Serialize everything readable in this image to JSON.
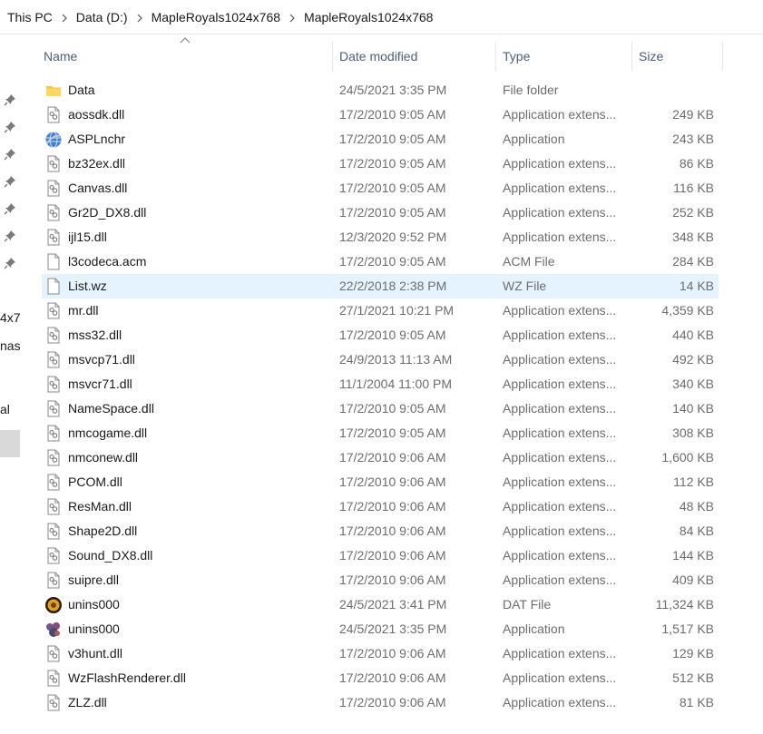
{
  "breadcrumb": [
    "This PC",
    "Data (D:)",
    "MapleRoyals1024x768",
    "MapleRoyals1024x768"
  ],
  "nav_fragments": [
    "4x7",
    "nas",
    "al"
  ],
  "columns": {
    "name": "Name",
    "date": "Date modified",
    "type": "Type",
    "size": "Size"
  },
  "colors": {
    "header_text": "#4c607a",
    "selected_row": "#e5f3ff",
    "folder": "#f6c445"
  },
  "files": [
    {
      "name": "Data",
      "date": "24/5/2021 3:35 PM",
      "type": "File folder",
      "size": "",
      "icon": "folder-icon"
    },
    {
      "name": "aossdk.dll",
      "date": "17/2/2010 9:05 AM",
      "type": "Application extens...",
      "size": "249 KB",
      "icon": "dll-file-icon"
    },
    {
      "name": "ASPLnchr",
      "date": "17/2/2010 9:05 AM",
      "type": "Application",
      "size": "243 KB",
      "icon": "globe-app-icon"
    },
    {
      "name": "bz32ex.dll",
      "date": "17/2/2010 9:05 AM",
      "type": "Application extens...",
      "size": "86 KB",
      "icon": "dll-file-icon"
    },
    {
      "name": "Canvas.dll",
      "date": "17/2/2010 9:05 AM",
      "type": "Application extens...",
      "size": "116 KB",
      "icon": "dll-file-icon"
    },
    {
      "name": "Gr2D_DX8.dll",
      "date": "17/2/2010 9:05 AM",
      "type": "Application extens...",
      "size": "252 KB",
      "icon": "dll-file-icon"
    },
    {
      "name": "ijl15.dll",
      "date": "12/3/2020 9:52 PM",
      "type": "Application extens...",
      "size": "348 KB",
      "icon": "dll-file-icon"
    },
    {
      "name": "l3codeca.acm",
      "date": "17/2/2010 9:05 AM",
      "type": "ACM File",
      "size": "284 KB",
      "icon": "blank-file-icon"
    },
    {
      "name": "List.wz",
      "date": "22/2/2018 2:38 PM",
      "type": "WZ File",
      "size": "14 KB",
      "icon": "blank-file-icon",
      "selected": true
    },
    {
      "name": "mr.dll",
      "date": "27/1/2021 10:21 PM",
      "type": "Application extens...",
      "size": "4,359 KB",
      "icon": "dll-file-icon"
    },
    {
      "name": "mss32.dll",
      "date": "17/2/2010 9:05 AM",
      "type": "Application extens...",
      "size": "440 KB",
      "icon": "dll-file-icon"
    },
    {
      "name": "msvcp71.dll",
      "date": "24/9/2013 11:13 AM",
      "type": "Application extens...",
      "size": "492 KB",
      "icon": "dll-file-icon"
    },
    {
      "name": "msvcr71.dll",
      "date": "11/1/2004 11:00 PM",
      "type": "Application extens...",
      "size": "340 KB",
      "icon": "dll-file-icon"
    },
    {
      "name": "NameSpace.dll",
      "date": "17/2/2010 9:05 AM",
      "type": "Application extens...",
      "size": "140 KB",
      "icon": "dll-file-icon"
    },
    {
      "name": "nmcogame.dll",
      "date": "17/2/2010 9:05 AM",
      "type": "Application extens...",
      "size": "308 KB",
      "icon": "dll-file-icon"
    },
    {
      "name": "nmconew.dll",
      "date": "17/2/2010 9:06 AM",
      "type": "Application extens...",
      "size": "1,600 KB",
      "icon": "dll-file-icon"
    },
    {
      "name": "PCOM.dll",
      "date": "17/2/2010 9:06 AM",
      "type": "Application extens...",
      "size": "112 KB",
      "icon": "dll-file-icon"
    },
    {
      "name": "ResMan.dll",
      "date": "17/2/2010 9:06 AM",
      "type": "Application extens...",
      "size": "48 KB",
      "icon": "dll-file-icon"
    },
    {
      "name": "Shape2D.dll",
      "date": "17/2/2010 9:06 AM",
      "type": "Application extens...",
      "size": "84 KB",
      "icon": "dll-file-icon"
    },
    {
      "name": "Sound_DX8.dll",
      "date": "17/2/2010 9:06 AM",
      "type": "Application extens...",
      "size": "144 KB",
      "icon": "dll-file-icon"
    },
    {
      "name": "suipre.dll",
      "date": "17/2/2010 9:06 AM",
      "type": "Application extens...",
      "size": "409 KB",
      "icon": "dll-file-icon"
    },
    {
      "name": "unins000",
      "date": "24/5/2021 3:41 PM",
      "type": "DAT File",
      "size": "11,324 KB",
      "icon": "maple-dat-icon"
    },
    {
      "name": "unins000",
      "date": "24/5/2021 3:35 PM",
      "type": "Application",
      "size": "1,517 KB",
      "icon": "installer-app-icon"
    },
    {
      "name": "v3hunt.dll",
      "date": "17/2/2010 9:06 AM",
      "type": "Application extens...",
      "size": "129 KB",
      "icon": "dll-file-icon"
    },
    {
      "name": "WzFlashRenderer.dll",
      "date": "17/2/2010 9:06 AM",
      "type": "Application extens...",
      "size": "512 KB",
      "icon": "dll-file-icon"
    },
    {
      "name": "ZLZ.dll",
      "date": "17/2/2010 9:06 AM",
      "type": "Application extens...",
      "size": "81 KB",
      "icon": "dll-file-icon"
    }
  ]
}
